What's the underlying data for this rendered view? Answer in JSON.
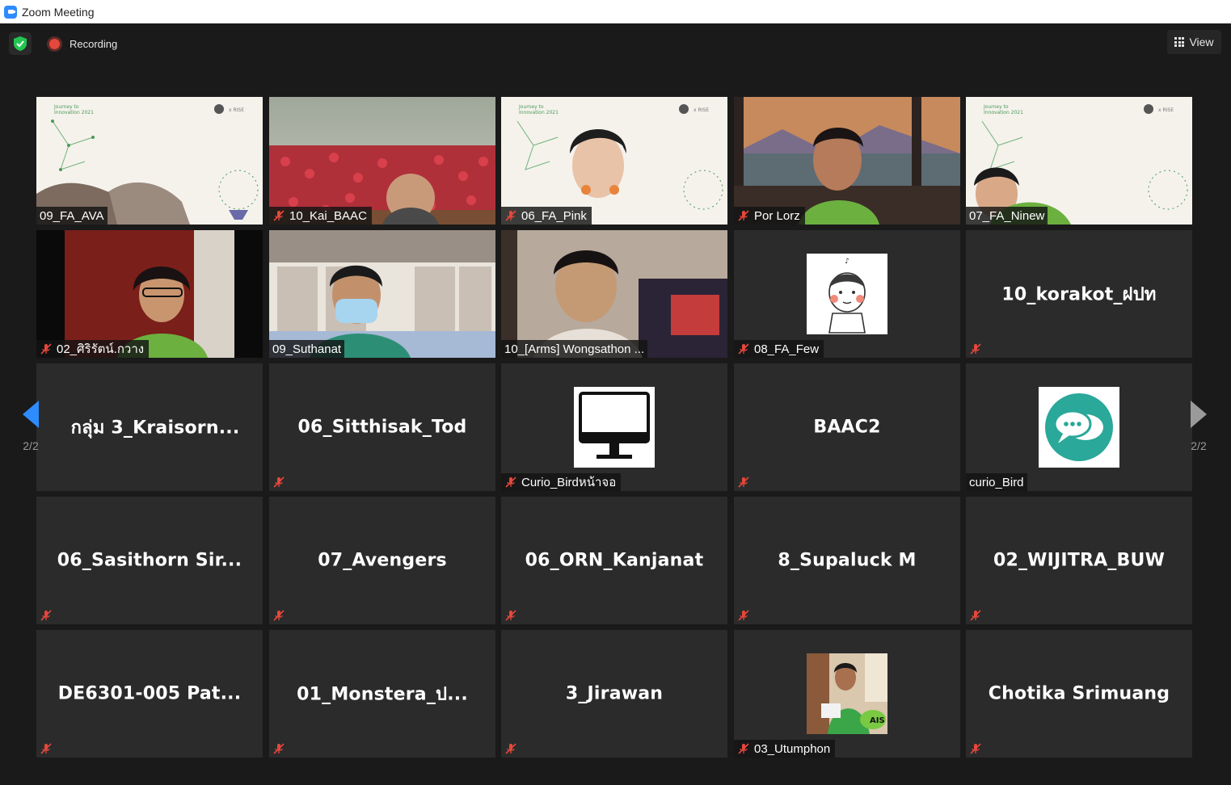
{
  "window": {
    "title": "Zoom Meeting"
  },
  "topbar": {
    "recording_label": "Recording",
    "view_label": "View"
  },
  "pagination": {
    "left_page": "2/2",
    "right_page": "2/2"
  },
  "tiles": [
    {
      "label": "09_FA_AVA",
      "muted": false
    },
    {
      "label": "10_Kai_BAAC",
      "muted": true
    },
    {
      "label": "06_FA_Pink",
      "muted": true
    },
    {
      "label": "Por Lorz",
      "muted": true
    },
    {
      "label": "07_FA_Ninew",
      "muted": false
    },
    {
      "label": "02_ศิริรัตน์.กวาง",
      "muted": true
    },
    {
      "label": "09_Suthanat",
      "muted": false
    },
    {
      "label": "10_[Arms] Wongsathon ...",
      "muted": false
    },
    {
      "label": "08_FA_Few",
      "muted": true
    },
    {
      "center": "10_korakot_ฝปท",
      "muted": true
    },
    {
      "center": "กลุ่ม 3_Kraisorn...",
      "muted": false
    },
    {
      "center": "06_Sitthisak_Tod",
      "muted": true
    },
    {
      "label": "Curio_Birdหน้าจอ",
      "muted": true
    },
    {
      "center": "BAAC2",
      "muted": true
    },
    {
      "label": "curio_Bird",
      "muted": false
    },
    {
      "center": "06_Sasithorn  Sir...",
      "muted": true
    },
    {
      "center": "07_Avengers",
      "muted": true
    },
    {
      "center": "06_ORN_Kanjanat",
      "muted": true
    },
    {
      "center": "8_Supaluck M",
      "muted": true
    },
    {
      "center": "02_WIJITRA_BUW",
      "muted": true
    },
    {
      "center": "DE6301-005  Pat...",
      "muted": true
    },
    {
      "center": "01_Monstera_ป...",
      "muted": true
    },
    {
      "center": "3_Jirawan",
      "muted": true
    },
    {
      "label": "03_Utumphon",
      "muted": true
    },
    {
      "center": "Chotika Srimuang",
      "muted": true
    }
  ],
  "colors": {
    "accent": "#2d8cff",
    "recording": "#e5483c",
    "muted": "#e5483c",
    "shield": "#23c552"
  }
}
